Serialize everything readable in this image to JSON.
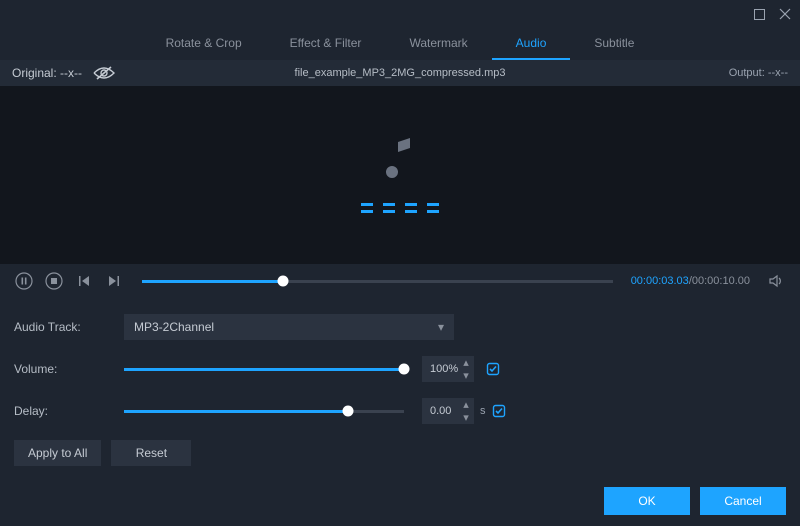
{
  "window": {
    "tabs": [
      "Rotate & Crop",
      "Effect & Filter",
      "Watermark",
      "Audio",
      "Subtitle"
    ],
    "active_tab": "Audio"
  },
  "infobar": {
    "original_label": "Original: --x--",
    "filename": "file_example_MP3_2MG_compressed.mp3",
    "output_label": "Output: --x--"
  },
  "playback": {
    "current_time": "00:00:03.03",
    "duration": "00:00:10.00",
    "progress_pct": 30
  },
  "settings": {
    "audio_track_label": "Audio Track:",
    "audio_track_value": "MP3-2Channel",
    "volume_label": "Volume:",
    "volume_value": "100%",
    "volume_pct": 100,
    "delay_label": "Delay:",
    "delay_value": "0.00",
    "delay_unit": "s",
    "delay_pct": 80,
    "apply_all_label": "Apply to All",
    "reset_label": "Reset"
  },
  "footer": {
    "ok_label": "OK",
    "cancel_label": "Cancel"
  },
  "colors": {
    "accent": "#1ea4ff",
    "bg": "#1e2530",
    "panel": "#2b3340"
  }
}
